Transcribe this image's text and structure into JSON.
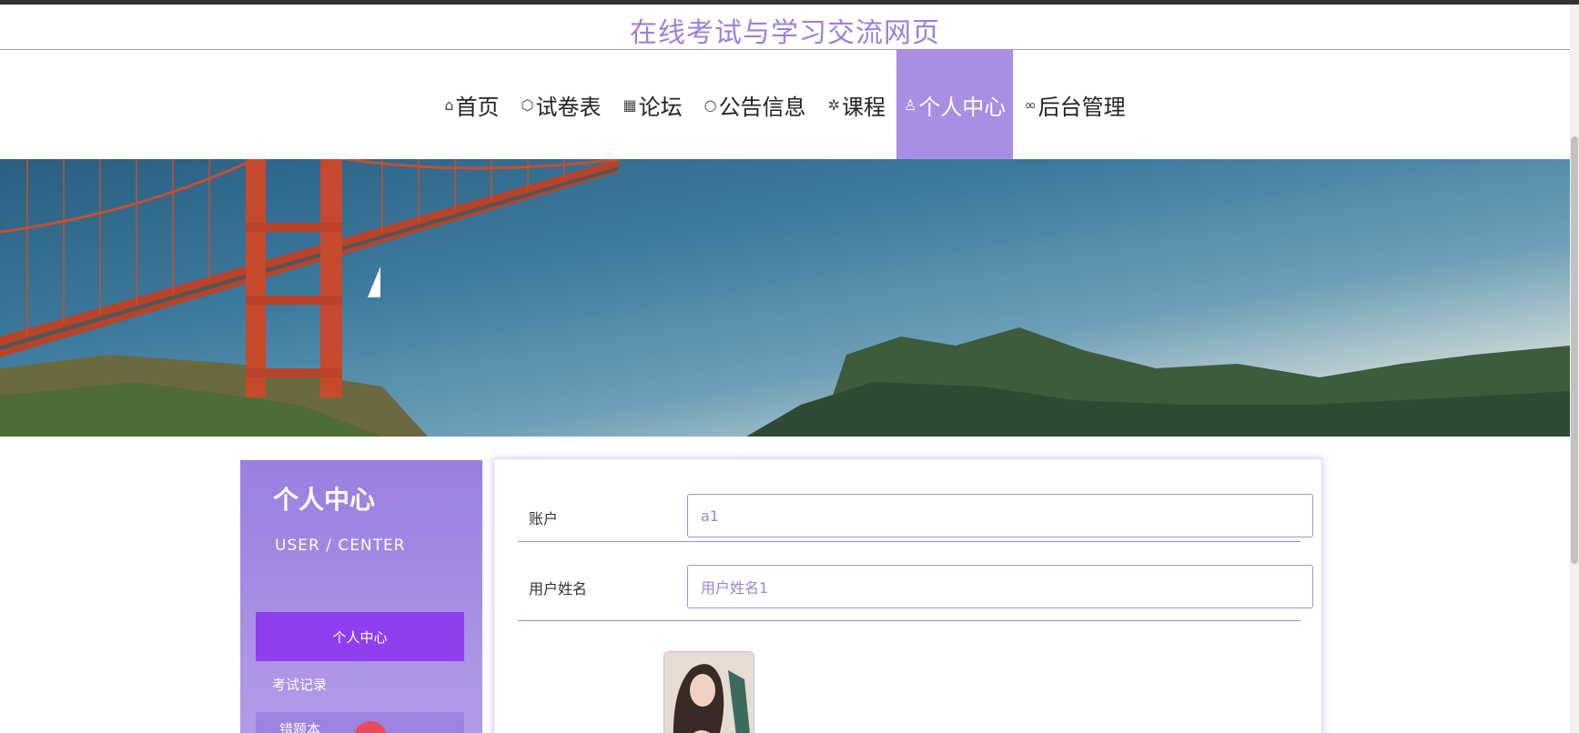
{
  "header": {
    "site_title": "在线考试与学习交流网页"
  },
  "nav": {
    "items": [
      {
        "label": "首页",
        "icon": "home-icon",
        "glyph": "⌂"
      },
      {
        "label": "试卷表",
        "icon": "cube-icon",
        "glyph": "⬡"
      },
      {
        "label": "论坛",
        "icon": "gift-icon",
        "glyph": "▦"
      },
      {
        "label": "公告信息",
        "icon": "smile-icon",
        "glyph": "○"
      },
      {
        "label": "课程",
        "icon": "gear-icon",
        "glyph": "✲"
      },
      {
        "label": "个人中心",
        "icon": "user-icon",
        "glyph": "♙",
        "active": true
      },
      {
        "label": "后台管理",
        "icon": "link-icon",
        "glyph": "∞"
      }
    ]
  },
  "banner": {
    "slides": 3,
    "active_index": 0
  },
  "sidebar": {
    "title": "个人中心",
    "subtitle": "USER / CENTER",
    "items": [
      {
        "label": "个人中心",
        "active": true
      },
      {
        "label": "考试记录"
      },
      {
        "label": "错题本"
      }
    ]
  },
  "form": {
    "fields": [
      {
        "label": "账户",
        "value": "a1"
      },
      {
        "label": "用户姓名",
        "value": "用户姓名1"
      }
    ]
  },
  "colors": {
    "accent": "#a98ee3",
    "active_menu": "#8e3ff0",
    "title": "#9b7fd9"
  }
}
